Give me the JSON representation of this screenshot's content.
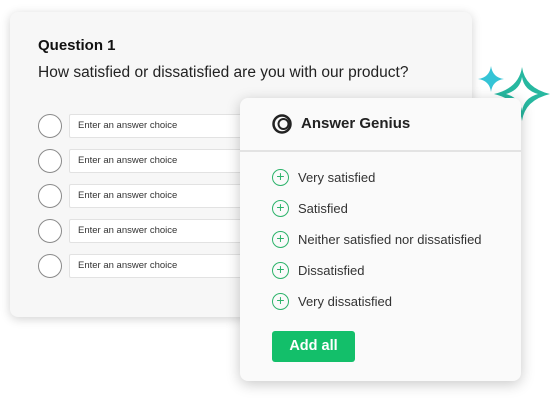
{
  "question": {
    "title": "Question 1",
    "text": "How satisfied or dissatisfied are you with our product?",
    "choices": [
      {
        "placeholder": "Enter an answer choice"
      },
      {
        "placeholder": "Enter an answer choice"
      },
      {
        "placeholder": "Enter an answer choice"
      },
      {
        "placeholder": "Enter an answer choice"
      },
      {
        "placeholder": "Enter an answer choice"
      }
    ]
  },
  "genius": {
    "title": "Answer Genius",
    "suggestions": [
      {
        "label": "Very satisfied"
      },
      {
        "label": "Satisfied"
      },
      {
        "label": "Neither satisfied nor dissatisfied"
      },
      {
        "label": "Dissatisfied"
      },
      {
        "label": "Very dissatisfied"
      }
    ],
    "add_all_label": "Add all"
  },
  "colors": {
    "accent_green": "#13bf6a",
    "icon_green": "#2db36b",
    "sparkle_teal": "#27b8a0",
    "sparkle_cyan": "#35c4d6",
    "sparkle_dark": "#0f7a3b"
  },
  "icons": {
    "logo": "answer-genius-logo-icon",
    "plus": "plus-circle-icon",
    "sparkle": "sparkle-icon"
  }
}
